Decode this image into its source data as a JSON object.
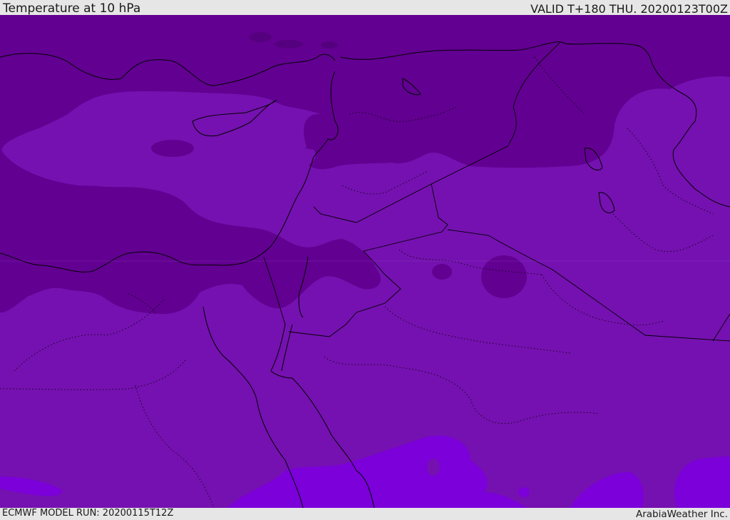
{
  "header": {
    "title": "Temperature at 10 hPa",
    "valid": "VALID T+180 THU. 20200123T00Z"
  },
  "footer": {
    "model_run": "ECMWF MODEL RUN: 20200115T12Z",
    "credit": "ArabiaWeather Inc."
  },
  "colors": {
    "cold_dark": "#620091",
    "mid": "#7511b0",
    "warm": "#7b00d9",
    "border_line": "#000000",
    "chrome": "#e6e6e6"
  }
}
